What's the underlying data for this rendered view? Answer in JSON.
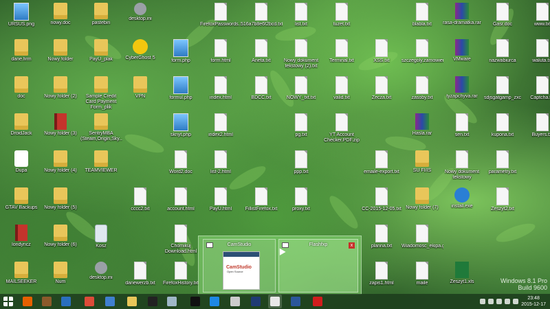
{
  "desktop": {
    "columns": [
      [
        {
          "label": "URSUS.png",
          "icon": "image"
        },
        {
          "label": "dane.firm",
          "icon": "folder"
        },
        {
          "label": "doc",
          "icon": "folder"
        },
        {
          "label": "DroidJack",
          "icon": "folder"
        },
        {
          "label": "Dupa",
          "icon": "dupa"
        },
        {
          "label": "GTAV Backups",
          "icon": "folder"
        },
        {
          "label": "londyncz",
          "icon": "book"
        },
        {
          "label": "MAILSEEKER",
          "icon": "folder"
        }
      ],
      [
        {
          "label": "nowy.doc",
          "icon": "folder"
        },
        {
          "label": "Nowy folder",
          "icon": "folder"
        },
        {
          "label": "Nowy folder (2)",
          "icon": "folder"
        },
        {
          "label": "Nowy folder (3)",
          "icon": "book"
        },
        {
          "label": "Nowy folder (4)",
          "icon": "folder"
        },
        {
          "label": "Nowy folder (5)",
          "icon": "folder"
        },
        {
          "label": "Nowy folder (6)",
          "icon": "folder"
        },
        {
          "label": "Num",
          "icon": "folder"
        }
      ],
      [
        {
          "label": "pastebin",
          "icon": "folder"
        },
        {
          "label": "PayU_plak",
          "icon": "folder"
        },
        {
          "label": "Sample Credit Card Payment Form_plik",
          "icon": "folder"
        },
        {
          "label": "SentryMBA (Steam,Origin,Sky...",
          "icon": "folder"
        },
        {
          "label": "TEAMVIEWER",
          "icon": "folder"
        },
        {
          "label": "",
          "icon": "none"
        },
        {
          "label": "Kosz",
          "icon": "trash"
        },
        {
          "label": "desktop.ini",
          "icon": "gear"
        }
      ],
      [
        {
          "label": "desktop.ini",
          "icon": "gear"
        },
        {
          "label": "CyberGhost 5",
          "icon": "cyber"
        },
        {
          "label": "VPN",
          "icon": "folder"
        },
        {
          "label": "",
          "icon": "none"
        },
        {
          "label": "",
          "icon": "none"
        },
        {
          "label": "cccc2.txt",
          "icon": "file"
        },
        {
          "label": "",
          "icon": "none"
        },
        {
          "label": "danewerzb.txt",
          "icon": "file"
        }
      ],
      [
        {
          "label": "",
          "icon": "none"
        },
        {
          "label": "form.php",
          "icon": "image"
        },
        {
          "label": "formul.php",
          "icon": "image"
        },
        {
          "label": "sknyt.php",
          "icon": "image"
        },
        {
          "label": "Word2.doc",
          "icon": "file"
        },
        {
          "label": "account.html",
          "icon": "file"
        },
        {
          "label": "Chomikuj Download.html",
          "icon": "file"
        },
        {
          "label": "FirefoxHistory.txt",
          "icon": "file"
        }
      ],
      [
        {
          "label": "FirefoxPasswords...",
          "icon": "file"
        },
        {
          "label": "form.html",
          "icon": "file"
        },
        {
          "label": "index.html",
          "icon": "file"
        },
        {
          "label": "index2.html",
          "icon": "file"
        },
        {
          "label": "list-2.html",
          "icon": "file"
        },
        {
          "label": "PayU.html",
          "icon": "file"
        },
        {
          "label": "",
          "icon": "none"
        },
        {
          "label": "",
          "icon": "none"
        }
      ],
      [
        {
          "label": "516a7b8e6f2bcd.txt",
          "icon": "file"
        },
        {
          "label": "Aneta.txt",
          "icon": "file"
        },
        {
          "label": "BDCC.txt",
          "icon": "file"
        },
        {
          "label": "",
          "icon": "none"
        },
        {
          "label": "",
          "icon": "none"
        },
        {
          "label": "FillistFirefox.txt",
          "icon": "file"
        },
        {
          "label": "",
          "icon": "none"
        },
        {
          "label": "",
          "icon": "none"
        }
      ],
      [
        {
          "label": "list.txt",
          "icon": "file"
        },
        {
          "label": "Nowy dokument tekstowy (2).txt",
          "icon": "file"
        },
        {
          "label": "NOWY_txt.txt",
          "icon": "file"
        },
        {
          "label": "pg.txt",
          "icon": "file"
        },
        {
          "label": "ppp.txt",
          "icon": "file"
        },
        {
          "label": "proxy.txt",
          "icon": "file"
        },
        {
          "label": "",
          "icon": "none"
        },
        {
          "label": "",
          "icon": "none"
        }
      ],
      [
        {
          "label": "tuzet.txt",
          "icon": "file"
        },
        {
          "label": "Terminal.txt",
          "icon": "file"
        },
        {
          "label": "valid.txt",
          "icon": "file"
        },
        {
          "label": "YT Account Checker.PDF.zip",
          "icon": "file"
        },
        {
          "label": "",
          "icon": "none"
        },
        {
          "label": "",
          "icon": "none"
        },
        {
          "label": "",
          "icon": "none"
        },
        {
          "label": "",
          "icon": "none"
        }
      ],
      [
        {
          "label": "",
          "icon": "none"
        },
        {
          "label": "XSS.txt",
          "icon": "file"
        },
        {
          "label": "Zecza.txt",
          "icon": "file"
        },
        {
          "label": "",
          "icon": "none"
        },
        {
          "label": "emaile-export.txt",
          "icon": "file"
        },
        {
          "label": "CC-2015-12-05.txt",
          "icon": "file"
        },
        {
          "label": "planna.txt",
          "icon": "file"
        },
        {
          "label": "zapis1.html",
          "icon": "file"
        }
      ],
      [
        {
          "label": "blabla.txt",
          "icon": "file"
        },
        {
          "label": "szczegoly.zamowienia",
          "icon": "file"
        },
        {
          "label": "zasoby.txt",
          "icon": "file"
        },
        {
          "label": "Hasla.rar",
          "icon": "rar"
        },
        {
          "label": "SU FI/IS",
          "icon": "folder"
        },
        {
          "label": "Nowy folder (7)",
          "icon": "folder"
        },
        {
          "label": "Wiadomosc_ekipa.gfpion",
          "icon": "file"
        },
        {
          "label": "maile",
          "icon": "file"
        }
      ],
      [
        {
          "label": "rasa-dramatka.rar",
          "icon": "rar"
        },
        {
          "label": "VMware",
          "icon": "rar"
        },
        {
          "label": "tyzapchyva.rar",
          "icon": "rar"
        },
        {
          "label": "sen.txt",
          "icon": "file"
        },
        {
          "label": "Nowy dokument tekstowy",
          "icon": "file"
        },
        {
          "label": "install.exe",
          "icon": "exe"
        },
        {
          "label": "",
          "icon": "none"
        },
        {
          "label": "Zeszyt1.xls",
          "icon": "xls"
        }
      ],
      [
        {
          "label": "Gasr.doc",
          "icon": "file"
        },
        {
          "label": "nazwabiurca",
          "icon": "file"
        },
        {
          "label": "sdjsgatgamp_zxc",
          "icon": "file"
        },
        {
          "label": "kupona.txt",
          "icon": "file"
        },
        {
          "label": "parametry.txt",
          "icon": "file"
        },
        {
          "label": "Zeszyt2.txt",
          "icon": "file"
        },
        {
          "label": "",
          "icon": "none"
        },
        {
          "label": "",
          "icon": "none"
        }
      ],
      [
        {
          "label": "www.txt",
          "icon": "file"
        },
        {
          "label": "waluta.txt",
          "icon": "file"
        },
        {
          "label": "Captcha.txt",
          "icon": "file"
        },
        {
          "label": "Buyers.txt",
          "icon": "file"
        },
        {
          "label": "",
          "icon": "none"
        },
        {
          "label": "",
          "icon": "none"
        },
        {
          "label": "",
          "icon": "none"
        },
        {
          "label": "",
          "icon": "none"
        }
      ]
    ]
  },
  "preview": {
    "camstudio_title": "CamStudio",
    "camstudio_brand": "CamStudio",
    "camstudio_sub": "Open Source",
    "flash_title": "Flashfxp",
    "flash_close": "x"
  },
  "taskbar": {
    "apps": [
      "start",
      "firefox",
      "gimp",
      "thunderbird",
      "chrome",
      "explorer",
      "folder",
      "cmd",
      "files",
      "blackapp",
      "ie",
      "printer",
      "photoshop",
      "flash-app",
      "word",
      "red-app"
    ],
    "app_colors": {
      "firefox": "#e66000",
      "gimp": "#8b5a2b",
      "thunderbird": "#2a6fbe",
      "chrome": "#dd4b39",
      "explorer": "#3f7fcf",
      "folder": "#e9c65a",
      "cmd": "#222222",
      "files": "#9fb7c7",
      "blackapp": "#111111",
      "ie": "#1e88e5",
      "printer": "#cccccc",
      "photoshop": "#1f3b73",
      "flash-app": "#e8e8e8",
      "word": "#2b579a",
      "red-app": "#d11d1d"
    }
  },
  "tray": {
    "time": "23:48",
    "date": "2015-12-17"
  },
  "watermark": {
    "line1": "Windows 8.1 Pro",
    "line2": "Build 9600"
  }
}
